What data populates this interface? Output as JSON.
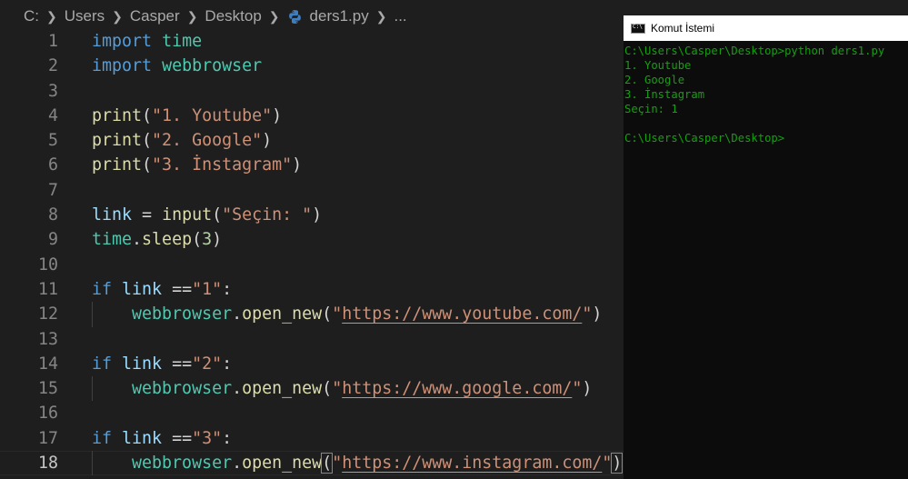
{
  "breadcrumb": {
    "items": [
      "C:",
      "Users",
      "Casper",
      "Desktop"
    ],
    "file": "ders1.py",
    "more": "..."
  },
  "editor": {
    "active_line": 18,
    "lines": [
      {
        "n": "1",
        "tokens": [
          {
            "t": "import",
            "c": "kw"
          },
          {
            "t": " ",
            "c": "pl"
          },
          {
            "t": "time",
            "c": "mod"
          }
        ]
      },
      {
        "n": "2",
        "tokens": [
          {
            "t": "import",
            "c": "kw"
          },
          {
            "t": " ",
            "c": "pl"
          },
          {
            "t": "webbrowser",
            "c": "mod"
          }
        ]
      },
      {
        "n": "3",
        "tokens": []
      },
      {
        "n": "4",
        "tokens": [
          {
            "t": "print",
            "c": "fn"
          },
          {
            "t": "(",
            "c": "pl"
          },
          {
            "t": "\"1. Youtube\"",
            "c": "str"
          },
          {
            "t": ")",
            "c": "pl"
          }
        ]
      },
      {
        "n": "5",
        "tokens": [
          {
            "t": "print",
            "c": "fn"
          },
          {
            "t": "(",
            "c": "pl"
          },
          {
            "t": "\"2. Google\"",
            "c": "str"
          },
          {
            "t": ")",
            "c": "pl"
          }
        ]
      },
      {
        "n": "6",
        "tokens": [
          {
            "t": "print",
            "c": "fn"
          },
          {
            "t": "(",
            "c": "pl"
          },
          {
            "t": "\"3. İnstagram\"",
            "c": "str"
          },
          {
            "t": ")",
            "c": "pl"
          }
        ]
      },
      {
        "n": "7",
        "tokens": []
      },
      {
        "n": "8",
        "tokens": [
          {
            "t": "link",
            "c": "var"
          },
          {
            "t": " = ",
            "c": "pl"
          },
          {
            "t": "input",
            "c": "fn"
          },
          {
            "t": "(",
            "c": "pl"
          },
          {
            "t": "\"Seçin: \"",
            "c": "str"
          },
          {
            "t": ")",
            "c": "pl"
          }
        ]
      },
      {
        "n": "9",
        "tokens": [
          {
            "t": "time",
            "c": "mod"
          },
          {
            "t": ".",
            "c": "pl"
          },
          {
            "t": "sleep",
            "c": "fn"
          },
          {
            "t": "(",
            "c": "pl"
          },
          {
            "t": "3",
            "c": "num"
          },
          {
            "t": ")",
            "c": "pl"
          }
        ]
      },
      {
        "n": "10",
        "tokens": []
      },
      {
        "n": "11",
        "tokens": [
          {
            "t": "if",
            "c": "kw"
          },
          {
            "t": " ",
            "c": "pl"
          },
          {
            "t": "link",
            "c": "var"
          },
          {
            "t": " ==",
            "c": "pl"
          },
          {
            "t": "\"1\"",
            "c": "str"
          },
          {
            "t": ":",
            "c": "pl"
          }
        ]
      },
      {
        "n": "12",
        "indent": true,
        "tokens": [
          {
            "t": "    ",
            "c": "pl"
          },
          {
            "t": "webbrowser",
            "c": "mod"
          },
          {
            "t": ".",
            "c": "pl"
          },
          {
            "t": "open_new",
            "c": "fn"
          },
          {
            "t": "(",
            "c": "pl"
          },
          {
            "t": "\"",
            "c": "str"
          },
          {
            "t": "https://www.youtube.com/",
            "c": "str url"
          },
          {
            "t": "\"",
            "c": "str"
          },
          {
            "t": ")",
            "c": "pl"
          }
        ]
      },
      {
        "n": "13",
        "tokens": []
      },
      {
        "n": "14",
        "tokens": [
          {
            "t": "if",
            "c": "kw"
          },
          {
            "t": " ",
            "c": "pl"
          },
          {
            "t": "link",
            "c": "var"
          },
          {
            "t": " ==",
            "c": "pl"
          },
          {
            "t": "\"2\"",
            "c": "str"
          },
          {
            "t": ":",
            "c": "pl"
          }
        ]
      },
      {
        "n": "15",
        "indent": true,
        "tokens": [
          {
            "t": "    ",
            "c": "pl"
          },
          {
            "t": "webbrowser",
            "c": "mod"
          },
          {
            "t": ".",
            "c": "pl"
          },
          {
            "t": "open_new",
            "c": "fn"
          },
          {
            "t": "(",
            "c": "pl"
          },
          {
            "t": "\"",
            "c": "str"
          },
          {
            "t": "https://www.google.com/",
            "c": "str url"
          },
          {
            "t": "\"",
            "c": "str"
          },
          {
            "t": ")",
            "c": "pl"
          }
        ]
      },
      {
        "n": "16",
        "tokens": []
      },
      {
        "n": "17",
        "tokens": [
          {
            "t": "if",
            "c": "kw"
          },
          {
            "t": " ",
            "c": "pl"
          },
          {
            "t": "link",
            "c": "var"
          },
          {
            "t": " ==",
            "c": "pl"
          },
          {
            "t": "\"3\"",
            "c": "str"
          },
          {
            "t": ":",
            "c": "pl"
          }
        ]
      },
      {
        "n": "18",
        "indent": true,
        "tokens": [
          {
            "t": "    ",
            "c": "pl"
          },
          {
            "t": "webbrowser",
            "c": "mod"
          },
          {
            "t": ".",
            "c": "pl"
          },
          {
            "t": "open_new",
            "c": "fn"
          },
          {
            "t": "(",
            "c": "pl bracket-box"
          },
          {
            "t": "\"",
            "c": "str"
          },
          {
            "t": "https://www.instagram.com/",
            "c": "str url"
          },
          {
            "t": "\"",
            "c": "str"
          },
          {
            "t": ")",
            "c": "pl bracket-box"
          }
        ]
      }
    ]
  },
  "terminal": {
    "title": "Komut İstemi",
    "lines": [
      "C:\\Users\\Casper\\Desktop>python ders1.py",
      "1. Youtube",
      "2. Google",
      "3. İnstagram",
      "Seçin: 1",
      "",
      "C:\\Users\\Casper\\Desktop>"
    ]
  },
  "colors": {
    "editor_bg": "#1e1e1e",
    "keyword": "#569cd6",
    "module": "#4ec9b0",
    "function": "#dcdcaa",
    "string": "#ce9178",
    "variable": "#9cdcfe",
    "number": "#b5cea8",
    "terminal_bg": "#0c0c0c",
    "terminal_text": "#13a10e"
  },
  "icons": {
    "file_icon": "python-file-icon",
    "terminal_icon": "command-prompt-icon"
  }
}
